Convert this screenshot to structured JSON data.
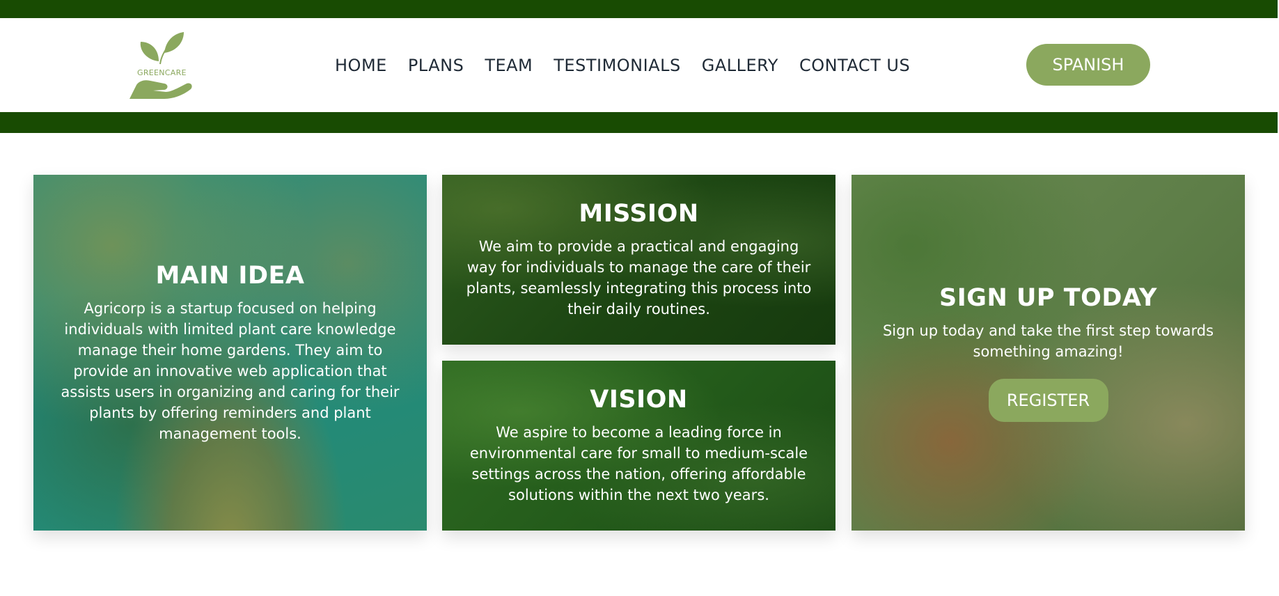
{
  "brand": {
    "logo_text": "GREENCARE"
  },
  "colors": {
    "dark_green": "#184B02",
    "accent_green": "#8BA85E",
    "nav_text": "#1F2A36",
    "white": "#FFFFFF"
  },
  "nav": {
    "items": [
      {
        "label": "HOME"
      },
      {
        "label": "PLANS"
      },
      {
        "label": "TEAM"
      },
      {
        "label": "TESTIMONIALS"
      },
      {
        "label": "GALLERY"
      },
      {
        "label": "CONTACT US"
      }
    ]
  },
  "header": {
    "language_button": "SPANISH"
  },
  "cards": {
    "main_idea": {
      "title": "MAIN IDEA",
      "text": "Agricorp is a startup focused on helping individuals with limited plant care knowledge manage their home gardens. They aim to provide an innovative web application that assists users in organizing and caring for their plants by offering reminders and plant management tools."
    },
    "mission": {
      "title": "MISSION",
      "text": "We aim to provide a practical and engaging way for individuals to manage the care of their plants, seamlessly integrating this process into their daily routines."
    },
    "vision": {
      "title": "VISION",
      "text": "We aspire to become a leading force in environmental care for small to medium-scale settings across the nation, offering affordable solutions within the next two years."
    },
    "signup": {
      "title": "SIGN UP TODAY",
      "text": "Sign up today and take the first step towards something amazing!",
      "button": "REGISTER"
    }
  }
}
